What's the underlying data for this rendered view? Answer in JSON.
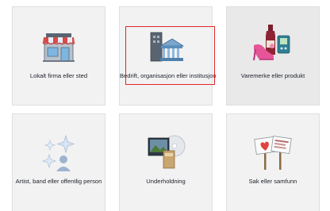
{
  "categories": [
    {
      "label": "Lokalt firma eller sted",
      "icon": "storefront-icon"
    },
    {
      "label": "Bedrift, organisasjon eller institusjon",
      "icon": "buildings-icon"
    },
    {
      "label": "Varemerke eller produkt",
      "icon": "products-icon"
    },
    {
      "label": "Artist, band eller offentlig person",
      "icon": "sparkles-icon"
    },
    {
      "label": "Underholdning",
      "icon": "media-icon"
    },
    {
      "label": "Sak eller samfunn",
      "icon": "protest-signs-icon"
    }
  ],
  "selected_index": 1,
  "hovered_index": 2,
  "colors": {
    "highlight_border": "#e0262b",
    "tile_background": "#f2f2f2",
    "tile_border": "#dddfe2"
  }
}
